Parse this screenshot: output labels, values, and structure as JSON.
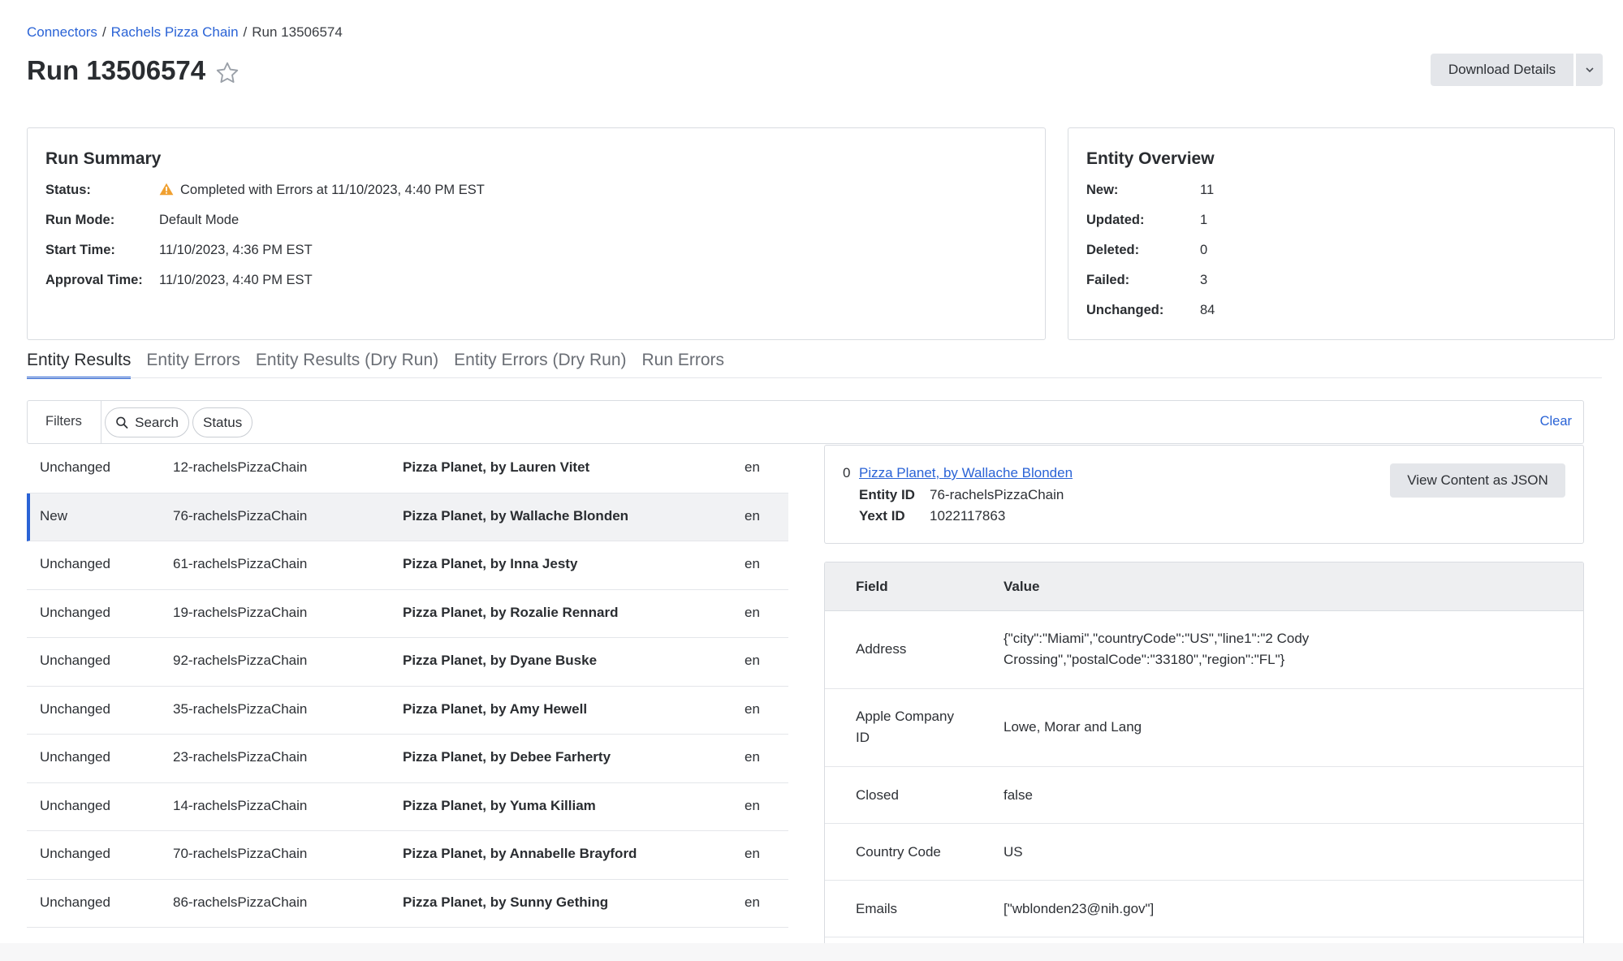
{
  "breadcrumb": {
    "connectors": "Connectors",
    "chain": "Rachels Pizza Chain",
    "current": "Run 13506574",
    "sep": "/"
  },
  "page": {
    "title": "Run 13506574",
    "download_label": "Download Details"
  },
  "summary": {
    "title": "Run Summary",
    "items": [
      {
        "k": "Status:",
        "v": "Completed with Errors at 11/10/2023, 4:40 PM EST"
      },
      {
        "k": "Run Mode:",
        "v": "Default Mode"
      },
      {
        "k": "Start Time:",
        "v": "11/10/2023, 4:36 PM EST"
      },
      {
        "k": "Approval Time:",
        "v": "11/10/2023, 4:40 PM EST"
      }
    ]
  },
  "overview": {
    "title": "Entity Overview",
    "items": [
      {
        "k": "New:",
        "v": "11"
      },
      {
        "k": "Updated:",
        "v": "1"
      },
      {
        "k": "Deleted:",
        "v": "0"
      },
      {
        "k": "Failed:",
        "v": "3"
      },
      {
        "k": "Unchanged:",
        "v": "84"
      }
    ]
  },
  "tabs": [
    "Entity Results",
    "Entity Errors",
    "Entity Results (Dry Run)",
    "Entity Errors (Dry Run)",
    "Run Errors"
  ],
  "filters": {
    "label": "Filters",
    "search": "Search",
    "status": "Status",
    "clear": "Clear"
  },
  "rows": [
    {
      "status": "Unchanged",
      "id": "12-rachelsPizzaChain",
      "name": "Pizza Planet, by Lauren Vitet",
      "lang": "en"
    },
    {
      "status": "New",
      "id": "76-rachelsPizzaChain",
      "name": "Pizza Planet, by Wallache Blonden",
      "lang": "en"
    },
    {
      "status": "Unchanged",
      "id": "61-rachelsPizzaChain",
      "name": "Pizza Planet, by Inna Jesty",
      "lang": "en"
    },
    {
      "status": "Unchanged",
      "id": "19-rachelsPizzaChain",
      "name": "Pizza Planet, by Rozalie Rennard",
      "lang": "en"
    },
    {
      "status": "Unchanged",
      "id": "92-rachelsPizzaChain",
      "name": "Pizza Planet, by Dyane Buske",
      "lang": "en"
    },
    {
      "status": "Unchanged",
      "id": "35-rachelsPizzaChain",
      "name": "Pizza Planet, by Amy Hewell",
      "lang": "en"
    },
    {
      "status": "Unchanged",
      "id": "23-rachelsPizzaChain",
      "name": "Pizza Planet, by Debee Farherty",
      "lang": "en"
    },
    {
      "status": "Unchanged",
      "id": "14-rachelsPizzaChain",
      "name": "Pizza Planet, by Yuma Killiam",
      "lang": "en"
    },
    {
      "status": "Unchanged",
      "id": "70-rachelsPizzaChain",
      "name": "Pizza Planet, by Annabelle Brayford",
      "lang": "en"
    },
    {
      "status": "Unchanged",
      "id": "86-rachelsPizzaChain",
      "name": "Pizza Planet, by Sunny Gething",
      "lang": "en"
    }
  ],
  "detail": {
    "index": "0",
    "title": "Pizza Planet, by Wallache Blonden",
    "entity_id_label": "Entity ID",
    "entity_id": "76-rachelsPizzaChain",
    "yext_id_label": "Yext ID",
    "yext_id": "1022117863",
    "json_button": "View Content as JSON"
  },
  "fields": {
    "head_field": "Field",
    "head_value": "Value",
    "rows": [
      {
        "f": "Address",
        "v": "{\"city\":\"Miami\",\"countryCode\":\"US\",\"line1\":\"2 Cody Crossing\",\"postalCode\":\"33180\",\"region\":\"FL\"}"
      },
      {
        "f": "Apple Company ID",
        "v": "Lowe, Morar and Lang"
      },
      {
        "f": "Closed",
        "v": "false"
      },
      {
        "f": "Country Code",
        "v": "US"
      },
      {
        "f": "Emails",
        "v": "[\"wblonden23@nih.gov\"]"
      }
    ]
  },
  "colors": {
    "accent": "#2a63d6",
    "warning": "#f0a030"
  }
}
